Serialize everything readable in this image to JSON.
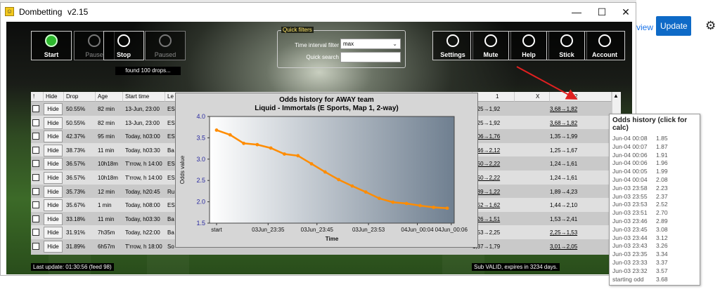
{
  "browser": {
    "view_label": "view",
    "update_label": "Update",
    "settings_icon": "gear-icon"
  },
  "window": {
    "title": "Dombetting",
    "version": "v2.15",
    "minimize": "—",
    "maximize": "☐",
    "close": "✕"
  },
  "toolbar": {
    "start": "Start",
    "pause": "Pause",
    "stop": "Stop",
    "paused": "Paused",
    "settings": "Settings",
    "mute": "Mute",
    "help": "Help",
    "stick": "Stick",
    "account": "Account"
  },
  "found_label": "found 100 drops...",
  "quick_filters": {
    "title": "Quick filters",
    "interval_label": "Time interval filter",
    "interval_value": "max",
    "search_label": "Quick search",
    "search_value": ""
  },
  "table": {
    "headers": {
      "bang": "!",
      "hide": "Hide",
      "drop": "Drop",
      "age": "Age",
      "start": "Start time",
      "league": "Le",
      "odd1": "1",
      "oddx": "X",
      "odd2": "2"
    },
    "hide_label": "Hide",
    "rows": [
      {
        "drop": "50.55%",
        "age": "82 min",
        "start": "13-Jun, 23:00",
        "league": "ES",
        "odd1": "1,25→1,92",
        "odd2": "3,68→1,82",
        "u1": false,
        "u2": true
      },
      {
        "drop": "50.55%",
        "age": "82 min",
        "start": "13-Jun, 23:00",
        "league": "ES",
        "odd1": "1,25→1,92",
        "odd2": "3,68→1,82",
        "u1": false,
        "u2": true
      },
      {
        "drop": "42.37%",
        "age": "95 min",
        "start": "Today, h03:00",
        "league": "ES",
        "odd1": "3,06→1,76",
        "odd2": "1,35→1,99",
        "u1": true,
        "u2": false
      },
      {
        "drop": "38.73%",
        "age": "11 min",
        "start": "Today, h03:30",
        "league": "Ba",
        "odd1": "3,46→2,12",
        "odd2": "1,25→1,67",
        "u1": true,
        "u2": false
      },
      {
        "drop": "36.57%",
        "age": "10h18m",
        "start": "T'rrow, h 14:00",
        "league": "ES",
        "odd1": "3,50→2,22",
        "odd2": "1,24→1,61",
        "u1": true,
        "u2": false
      },
      {
        "drop": "36.57%",
        "age": "10h18m",
        "start": "T'rrow, h 14:00",
        "league": "ES",
        "odd1": "3,50→2,22",
        "odd2": "1,24→1,61",
        "u1": true,
        "u2": false
      },
      {
        "drop": "35.73%",
        "age": "12 min",
        "start": "Today, h20:45",
        "league": "Ru",
        "odd1": "1,89→1,22",
        "odd2": "1,89→4,23",
        "u1": true,
        "u2": false
      },
      {
        "drop": "35.67%",
        "age": "1 min",
        "start": "Today, h08:00",
        "league": "ES",
        "odd1": "2,52→1,62",
        "odd2": "1,44→2,10",
        "u1": true,
        "u2": false
      },
      {
        "drop": "33.18%",
        "age": "11 min",
        "start": "Today, h03:30",
        "league": "Ba",
        "odd1": "2,26→1,51",
        "odd2": "1,53→2,41",
        "u1": true,
        "u2": false
      },
      {
        "drop": "31.91%",
        "age": "7h35m",
        "start": "Today, h22:00",
        "league": "Ba",
        "odd1": "1,53→2,25",
        "odd2": "2,25→1,53",
        "u1": false,
        "u2": true
      },
      {
        "drop": "31.89%",
        "age": "6h57m",
        "start": "T'rrow, h 18:00",
        "league": "So",
        "odd1": "1,37→1,79",
        "odd2": "3,01→2,05",
        "u1": false,
        "u2": true
      }
    ]
  },
  "chart": {
    "title": "Odds history for AWAY team",
    "subtitle": "Liquid - Immortals (E Sports, Map 1, 2-way)",
    "ylabel": "Odds value",
    "xlabel": "Time"
  },
  "chart_data": {
    "type": "line",
    "title": "Odds history for AWAY team",
    "subtitle": "Liquid - Immortals (E Sports, Map 1, 2-way)",
    "xlabel": "Time",
    "ylabel": "Odds value",
    "ylim": [
      1.5,
      4.0
    ],
    "yticks": [
      "4.0",
      "3.5",
      "3.0",
      "2.5",
      "2.0",
      "1.5"
    ],
    "xticks": [
      "start",
      "03Jun_23:35",
      "03Jun_23:45",
      "03Jun_23:53",
      "04Jun_00:04",
      "04Jun_00:06"
    ],
    "values": [
      3.68,
      3.57,
      3.37,
      3.34,
      3.26,
      3.12,
      3.08,
      2.89,
      2.7,
      2.52,
      2.37,
      2.23,
      2.08,
      1.99,
      1.96,
      1.91,
      1.87,
      1.85
    ],
    "series_color": "#ff8c00",
    "grid": false
  },
  "status": {
    "last_update": "Last update: 01:30:56 (feed 98)",
    "sub_valid": "Sub VALID, expires in 3234 days."
  },
  "tooltip": {
    "title": "Odds history (click for calc)",
    "rows": [
      {
        "t": "Jun-04 00:08",
        "v": "1.85"
      },
      {
        "t": "Jun-04 00:07",
        "v": "1.87"
      },
      {
        "t": "Jun-04 00:06",
        "v": "1.91"
      },
      {
        "t": "Jun-04 00:06",
        "v": "1.96"
      },
      {
        "t": "Jun-04 00:05",
        "v": "1.99"
      },
      {
        "t": "Jun-04 00:04",
        "v": "2.08"
      },
      {
        "t": "Jun-03 23:58",
        "v": "2.23"
      },
      {
        "t": "Jun-03 23:55",
        "v": "2.37"
      },
      {
        "t": "Jun-03 23:53",
        "v": "2.52"
      },
      {
        "t": "Jun-03 23:51",
        "v": "2.70"
      },
      {
        "t": "Jun-03 23:46",
        "v": "2.89"
      },
      {
        "t": "Jun-03 23:45",
        "v": "3.08"
      },
      {
        "t": "Jun-03 23:44",
        "v": "3.12"
      },
      {
        "t": "Jun-03 23:43",
        "v": "3.26"
      },
      {
        "t": "Jun-03 23:35",
        "v": "3.34"
      },
      {
        "t": "Jun-03 23:33",
        "v": "3.37"
      },
      {
        "t": "Jun-03 23:32",
        "v": "3.57"
      },
      {
        "t": "starting odd",
        "v": "3.68"
      }
    ]
  },
  "colors": {
    "accent": "#0e6ac7",
    "chart_line": "#ff8c00",
    "arrow": "#e02020"
  }
}
